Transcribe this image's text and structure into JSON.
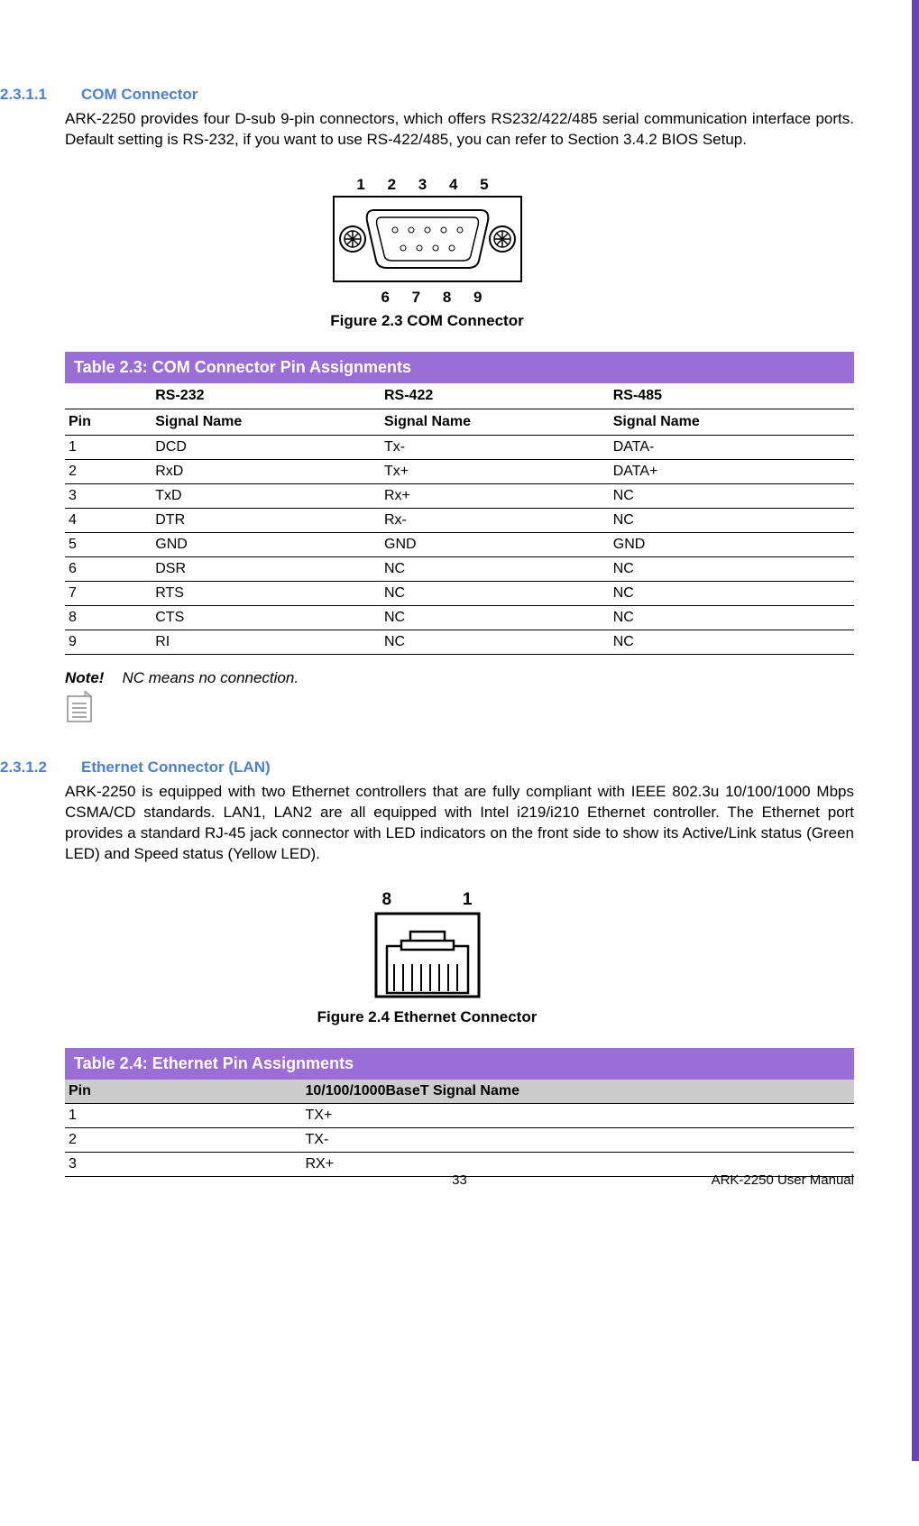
{
  "section1": {
    "num": "2.3.1.1",
    "title": "COM Connector",
    "body": "ARK-2250 provides four D-sub 9-pin connectors, which offers RS232/422/485 serial communication interface ports. Default setting is RS-232, if you want to use RS-422/485, you can refer to Section 3.4.2 BIOS Setup."
  },
  "figure1": {
    "top_labels": "1  2  3  4  5",
    "bot_labels": "6  7  8  9",
    "caption": "Figure 2.3 COM Connector"
  },
  "table1": {
    "title": "Table 2.3: COM Connector Pin Assignments",
    "mode_headers": [
      "",
      "RS-232",
      "RS-422",
      "RS-485"
    ],
    "col_headers": [
      "Pin",
      "Signal Name",
      "Signal Name",
      "Signal Name"
    ],
    "rows": [
      [
        "1",
        "DCD",
        "Tx-",
        "DATA-"
      ],
      [
        "2",
        "RxD",
        "Tx+",
        "DATA+"
      ],
      [
        "3",
        "TxD",
        "Rx+",
        "NC"
      ],
      [
        "4",
        "DTR",
        "Rx-",
        "NC"
      ],
      [
        "5",
        "GND",
        "GND",
        "GND"
      ],
      [
        "6",
        "DSR",
        "NC",
        "NC"
      ],
      [
        "7",
        "RTS",
        "NC",
        "NC"
      ],
      [
        "8",
        "CTS",
        "NC",
        "NC"
      ],
      [
        "9",
        "RI",
        "NC",
        "NC"
      ]
    ]
  },
  "note": {
    "label": "Note!",
    "text": "NC means no connection."
  },
  "section2": {
    "num": "2.3.1.2",
    "title": "Ethernet Connector (LAN)",
    "body": "ARK-2250 is equipped with two Ethernet controllers that are fully compliant with IEEE 802.3u 10/100/1000 Mbps CSMA/CD standards. LAN1, LAN2 are all equipped with Intel i219/i210 Ethernet controller. The Ethernet port provides a standard RJ-45 jack connector with LED indicators on the front side to show its Active/Link status (Green LED) and Speed status (Yellow LED)."
  },
  "figure2": {
    "left_label": "8",
    "right_label": "1",
    "caption": "Figure 2.4 Ethernet Connector"
  },
  "table2": {
    "title": "Table 2.4: Ethernet  Pin Assignments",
    "col_headers": [
      "Pin",
      "10/100/1000BaseT Signal Name"
    ],
    "rows": [
      [
        "1",
        "TX+"
      ],
      [
        "2",
        "TX-"
      ],
      [
        "3",
        "RX+"
      ]
    ]
  },
  "footer": {
    "page": "33",
    "doc": "ARK-2250 User Manual"
  }
}
